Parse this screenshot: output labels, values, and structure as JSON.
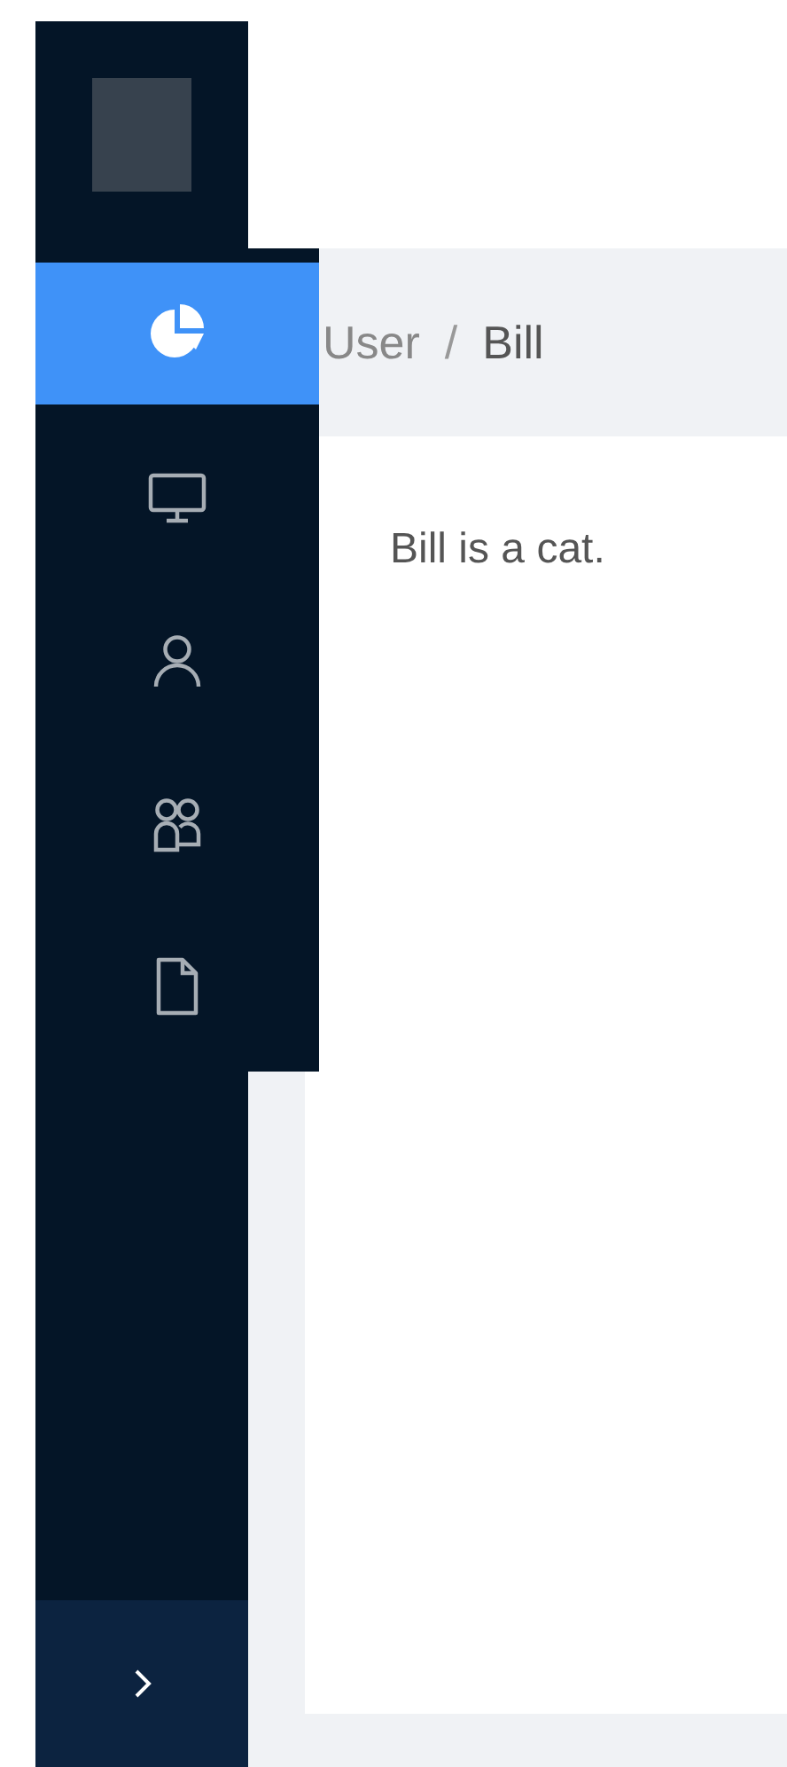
{
  "sider": {
    "collapsed": true
  },
  "menu": {
    "items": [
      {
        "selected": true
      },
      {
        "selected": false
      },
      {
        "selected": false
      },
      {
        "selected": false
      },
      {
        "selected": false
      }
    ]
  },
  "breadcrumb": {
    "separator": "/",
    "items": [
      "User",
      "Bill"
    ]
  },
  "content": {
    "text": "Bill is a cat."
  }
}
